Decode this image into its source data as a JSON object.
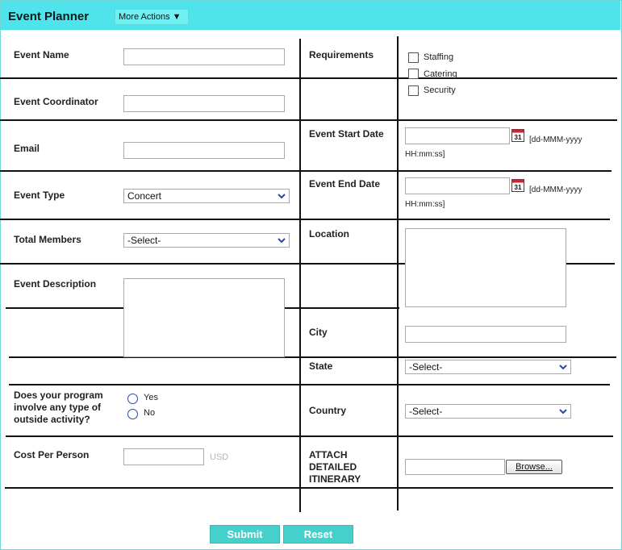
{
  "header": {
    "title": "Event Planner",
    "more_actions": "More Actions ▼"
  },
  "form": {
    "event_name": {
      "label": "Event Name",
      "value": ""
    },
    "event_coordinator": {
      "label": "Event Coordinator",
      "value": ""
    },
    "email": {
      "label": "Email",
      "value": ""
    },
    "event_type": {
      "label": "Event Type",
      "selected": "Concert"
    },
    "total_members": {
      "label": "Total Members",
      "selected": "-Select-"
    },
    "event_description": {
      "label": "Event Description",
      "value": ""
    },
    "outside_activity": {
      "label_lines": [
        "Does your program",
        "involve any type of",
        "outside activity?"
      ],
      "options": [
        "Yes",
        "No"
      ]
    },
    "cost_per_person": {
      "label": "Cost Per Person",
      "value": "",
      "unit": "USD"
    },
    "requirements": {
      "label": "Requirements",
      "options": [
        "Staffing",
        "Catering",
        "Security"
      ]
    },
    "event_start_date": {
      "label": "Event Start Date",
      "value": "",
      "hint_1": "[dd-MMM-yyyy",
      "hint_2": "HH:mm:ss]",
      "calendar_day": "31"
    },
    "event_end_date": {
      "label": "Event End Date",
      "value": "",
      "hint_1": "[dd-MMM-yyyy",
      "hint_2": "HH:mm:ss]",
      "calendar_day": "31"
    },
    "location": {
      "label": "Location",
      "value": ""
    },
    "city": {
      "label": "City",
      "value": ""
    },
    "state": {
      "label": "State",
      "selected": "-Select-"
    },
    "country": {
      "label": "Country",
      "selected": "-Select-"
    },
    "attach": {
      "label_lines": [
        "ATTACH",
        "DETAILED",
        "ITINERARY"
      ],
      "browse": "Browse..."
    }
  },
  "actions": {
    "submit": "Submit",
    "reset": "Reset"
  },
  "colors": {
    "header_bg": "#4fe4ec",
    "button_bg": "#46d0cc"
  },
  "icons": {
    "calendar": "calendar-icon",
    "dropdown": "chevron-down-icon"
  }
}
